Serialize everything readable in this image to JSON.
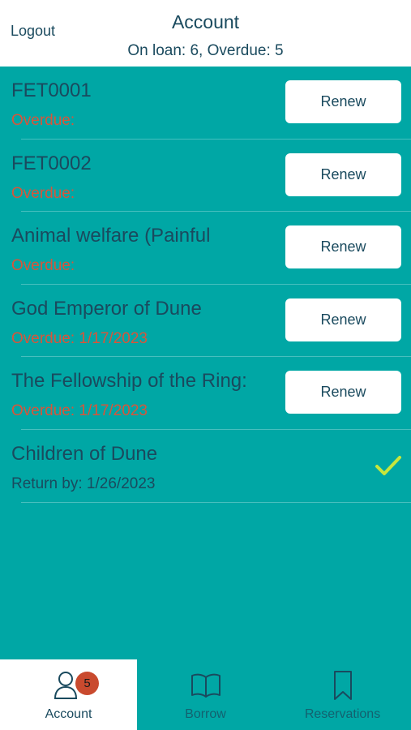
{
  "header": {
    "logout_label": "Logout",
    "title": "Account",
    "subtitle": "On loan: 6, Overdue: 5"
  },
  "loans": [
    {
      "title": "FET0001",
      "status": "Overdue:",
      "overdue": true,
      "action": "Renew"
    },
    {
      "title": "FET0002",
      "status": "Overdue:",
      "overdue": true,
      "action": "Renew"
    },
    {
      "title": "Animal welfare (Painful",
      "status": "Overdue:",
      "overdue": true,
      "action": "Renew"
    },
    {
      "title": "God Emperor of Dune",
      "status": "Overdue: 1/17/2023",
      "overdue": true,
      "action": "Renew"
    },
    {
      "title": "The Fellowship of the Ring:",
      "status": "Overdue: 1/17/2023",
      "overdue": true,
      "action": "Renew"
    },
    {
      "title": "Children of Dune",
      "status": "Return by: 1/26/2023",
      "overdue": false,
      "icon": "checkmark-icon"
    }
  ],
  "tabs": [
    {
      "label": "Account",
      "icon": "account-icon",
      "badge": "5",
      "active": true
    },
    {
      "label": "Borrow",
      "icon": "book-icon",
      "active": false
    },
    {
      "label": "Reservations",
      "icon": "bookmark-icon",
      "active": false
    }
  ],
  "colors": {
    "teal_background": "#00a7a5",
    "text_dark": "#1a4a5e",
    "overdue_red": "#d8553a",
    "check_green": "#c8e63c",
    "badge_red": "#c94a2e"
  }
}
